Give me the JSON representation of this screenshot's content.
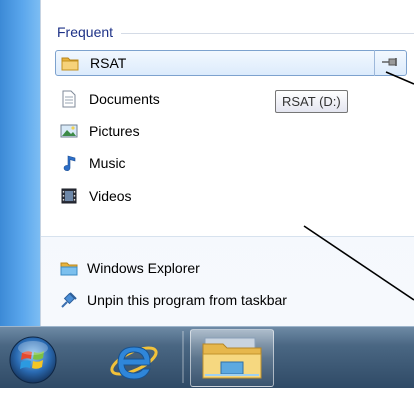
{
  "jumplist": {
    "frequent_header": "Frequent",
    "items": [
      {
        "label": "RSAT",
        "icon": "folder-icon"
      },
      {
        "label": "Documents",
        "icon": "document-icon"
      },
      {
        "label": "Pictures",
        "icon": "pictures-icon"
      },
      {
        "label": "Music",
        "icon": "music-icon"
      },
      {
        "label": "Videos",
        "icon": "videos-icon"
      }
    ],
    "tooltip": "RSAT (D:)",
    "tasks": [
      {
        "label": "Windows Explorer",
        "icon": "windows-explorer-icon"
      },
      {
        "label": "Unpin this program from taskbar",
        "icon": "unpin-icon"
      }
    ]
  },
  "taskbar": {
    "buttons": [
      {
        "name": "start-button",
        "icon": "windows-orb-icon"
      },
      {
        "name": "internet-explorer-button",
        "icon": "ie-icon"
      },
      {
        "name": "windows-explorer-button",
        "icon": "folder-library-icon"
      }
    ]
  },
  "colors": {
    "header_text": "#1e3287",
    "selection_border": "#7da2ce",
    "left_strip": "#4f9ae4"
  }
}
